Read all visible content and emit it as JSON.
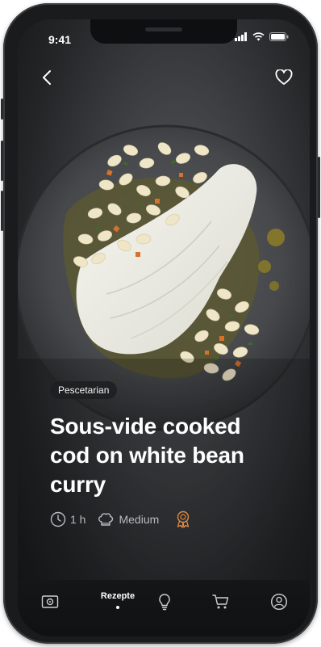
{
  "status_bar": {
    "time": "9:41"
  },
  "recipe": {
    "tag": "Pescetarian",
    "title": "Sous-vide cooked cod on white bean curry",
    "duration": "1 h",
    "difficulty": "Medium"
  },
  "tabbar": {
    "active_label": "Rezepte"
  },
  "colors": {
    "accent_orange": "#e08a45",
    "background_dark": "#242527",
    "text_primary": "#ffffff",
    "text_secondary": "#b9babd"
  },
  "icons": [
    "back-arrow-icon",
    "heart-icon",
    "clock-icon",
    "chef-hat-icon",
    "award-icon",
    "camera-icon",
    "lightbulb-icon",
    "cart-icon",
    "profile-icon",
    "signal-icon",
    "wifi-icon",
    "battery-icon"
  ]
}
